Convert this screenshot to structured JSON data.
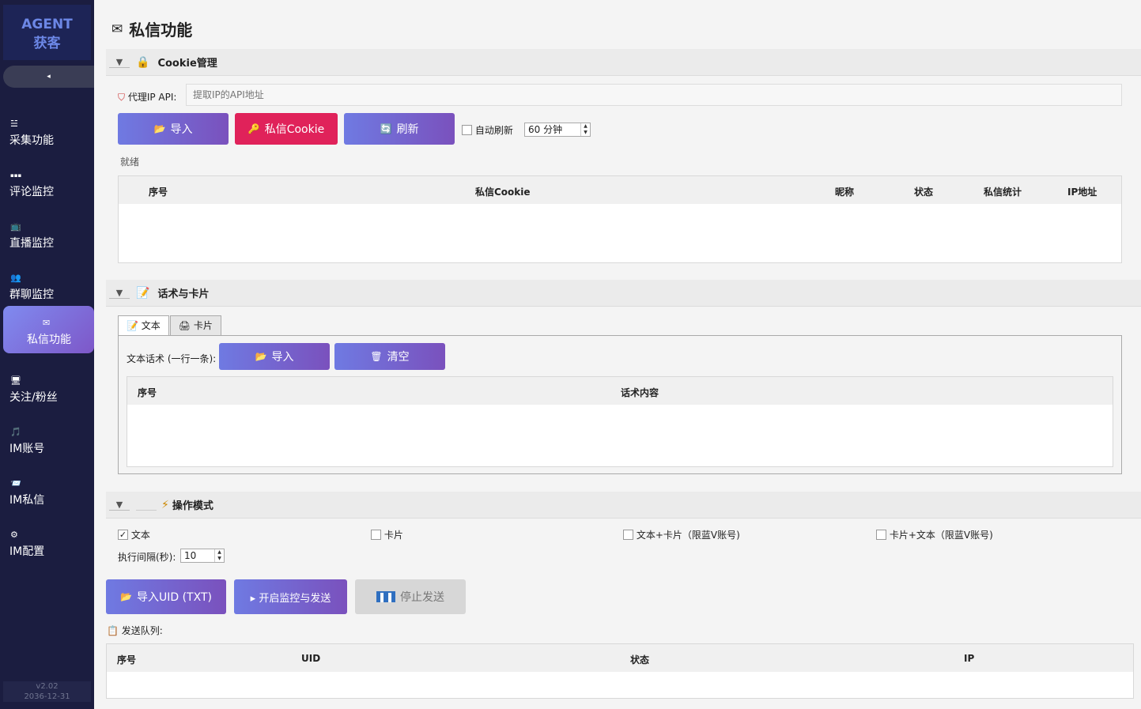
{
  "sidebar": {
    "brand_line1": "AGENT",
    "brand_line2": "获客",
    "collapse": "◂",
    "items": [
      {
        "icon": "☱",
        "label": "采集功能"
      },
      {
        "icon": "▪▪▪",
        "label": "评论监控"
      },
      {
        "icon": "📺",
        "label": "直播监控"
      },
      {
        "icon": "👥",
        "label": "群聊监控"
      },
      {
        "icon": "✉",
        "label": "私信功能"
      },
      {
        "icon": "🖥",
        "label": "关注/粉丝"
      },
      {
        "icon": "🎵",
        "label": "IM账号"
      },
      {
        "icon": "📨",
        "label": "IM私信"
      },
      {
        "icon": "⚙",
        "label": "IM配置"
      }
    ],
    "version": "v2.02",
    "date": "2036-12-31"
  },
  "page": {
    "title": "私信功能",
    "title_icon": "✉"
  },
  "cookie": {
    "section_title": "Cookie管理",
    "proxy_label": "代理IP API:",
    "proxy_placeholder": "提取IP的API地址",
    "import_btn": "导入",
    "cookie_btn": "私信Cookie",
    "refresh_btn": "刷新",
    "auto_refresh": "自动刷新",
    "interval": "60 分钟",
    "status": "就绪",
    "columns": [
      "序号",
      "私信Cookie",
      "昵称",
      "状态",
      "私信统计",
      "IP地址"
    ]
  },
  "script": {
    "section_title": "话术与卡片",
    "tabs": [
      "文本",
      "卡片"
    ],
    "label": "文本话术 (一行一条):",
    "import_btn": "导入",
    "clear_btn": "清空",
    "columns": [
      "序号",
      "话术内容"
    ]
  },
  "mode": {
    "section_title": "操作模式",
    "options": [
      "文本",
      "卡片",
      "文本+卡片（限蓝V账号)",
      "卡片+文本（限蓝V账号)"
    ],
    "checked": [
      true,
      false,
      false,
      false
    ],
    "interval_label": "执行间隔(秒):",
    "interval_value": "10",
    "import_uid_btn": "导入UID (TXT)",
    "start_btn": "▸ 开启监控与发送",
    "stop_btn": "停止发送",
    "queue_label": "发送队列:",
    "columns": [
      "序号",
      "UID",
      "状态",
      "IP"
    ]
  }
}
